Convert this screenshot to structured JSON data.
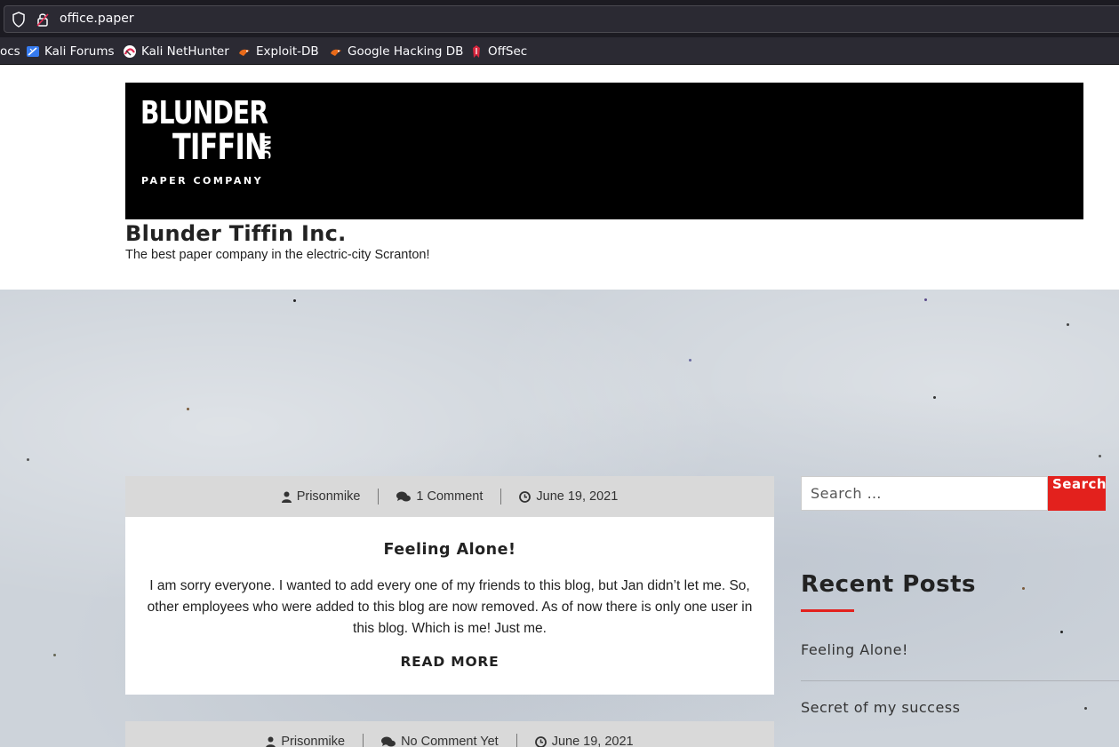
{
  "browser": {
    "url": "office.paper",
    "bookmarks": [
      {
        "label": "ocs",
        "icon": "docs-icon"
      },
      {
        "label": "Kali Forums",
        "icon": "kali-forums-icon"
      },
      {
        "label": "Kali NetHunter",
        "icon": "kali-nethunter-icon"
      },
      {
        "label": "Exploit-DB",
        "icon": "exploit-db-icon"
      },
      {
        "label": "Google Hacking DB",
        "icon": "google-hacking-db-icon"
      },
      {
        "label": "OffSec",
        "icon": "offsec-icon"
      }
    ]
  },
  "site": {
    "logo": {
      "line1": "BLUNDER",
      "line2": "TIFFIN",
      "inc": "INC",
      "line3": "PAPER COMPANY"
    },
    "title": "Blunder Tiffin Inc.",
    "description": "The best paper company in the electric-city Scranton!"
  },
  "posts": [
    {
      "author": "Prisonmike",
      "comments": "1 Comment",
      "date": "June 19, 2021",
      "title": "Feeling Alone!",
      "excerpt": "I am sorry everyone. I wanted to add every one of my friends to this blog, but Jan didn’t let me. So, other employees who were added to this blog are now removed. As of now there is only one user in this blog. Which is me! Just me.",
      "read_more": "READ MORE"
    },
    {
      "author": "Prisonmike",
      "comments": "No Comment Yet",
      "date": "June 19, 2021"
    }
  ],
  "sidebar": {
    "search_placeholder": "Search …",
    "search_button": "Search",
    "recent_title": "Recent Posts",
    "recent_posts": [
      "Feeling Alone!",
      "Secret of my success"
    ]
  },
  "colors": {
    "accent": "#e3211d",
    "chrome_bg": "#2b2a33",
    "banner_bg": "#000000"
  }
}
